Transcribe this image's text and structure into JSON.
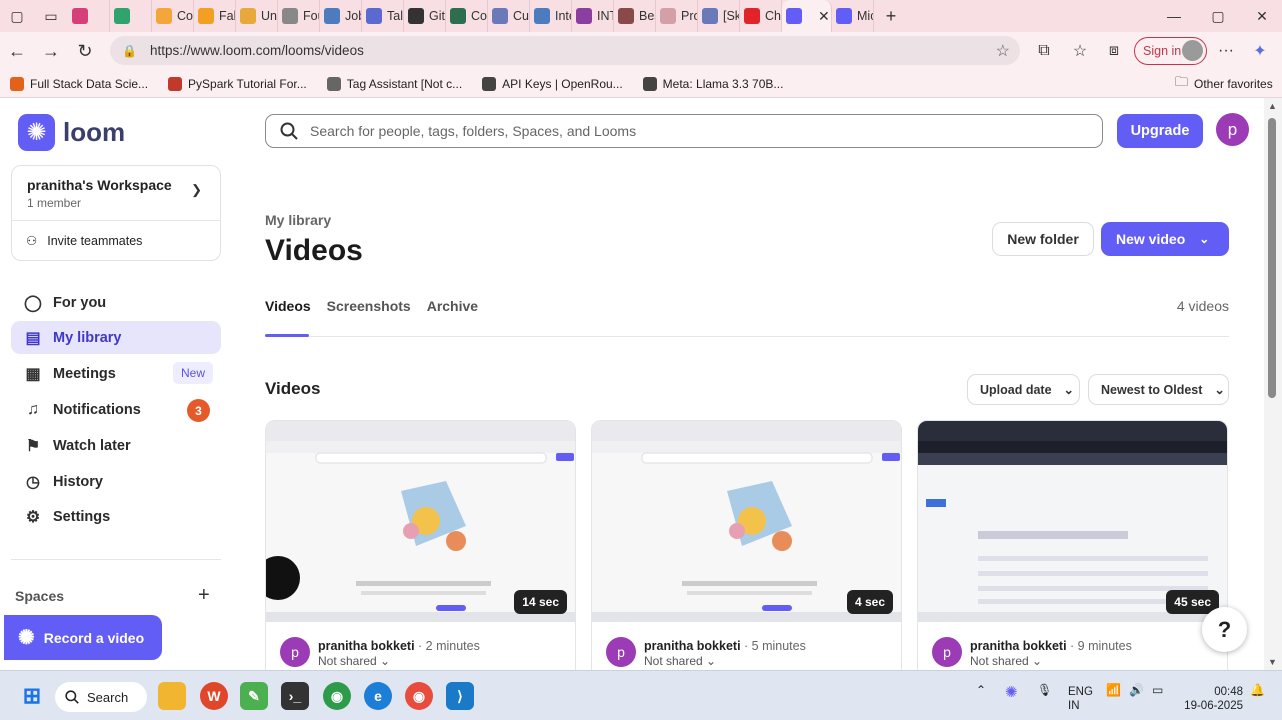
{
  "browser": {
    "tabs": [
      {
        "label": "",
        "color": "#d6407a"
      },
      {
        "label": "",
        "color": "#2fa36b"
      },
      {
        "label": "Cola",
        "color": "#f3a73b"
      },
      {
        "label": "Fake",
        "color": "#f1a024"
      },
      {
        "label": "Unti",
        "color": "#e8a93c"
      },
      {
        "label": "Fou",
        "color": "#888888"
      },
      {
        "label": "Jobs",
        "color": "#4d7cbe"
      },
      {
        "label": "Tale",
        "color": "#5a6ad1"
      },
      {
        "label": "GitH",
        "color": "#333333"
      },
      {
        "label": "Core",
        "color": "#2f6d4f"
      },
      {
        "label": "Cust",
        "color": "#6a7ab8"
      },
      {
        "label": "Inte",
        "color": "#4d7cbe"
      },
      {
        "label": "INTE",
        "color": "#8b3fa0"
      },
      {
        "label": "Best",
        "color": "#8a4a4a"
      },
      {
        "label": "Proc",
        "color": "#d3a0a8"
      },
      {
        "label": "[Ski",
        "color": "#6a7ab8"
      },
      {
        "label": "Cha",
        "color": "#e0242a"
      },
      {
        "label": "",
        "color": "#625df5",
        "active": true
      },
      {
        "label": "Mic",
        "color": "#625df5"
      }
    ],
    "url": "https://www.loom.com/looms/videos",
    "signin_label": "Sign in",
    "bookmarks": [
      {
        "label": "Full Stack Data Scie...",
        "color": "#e2621a"
      },
      {
        "label": "PySpark Tutorial For...",
        "color": "#c0392b"
      },
      {
        "label": "Tag Assistant [Not c...",
        "color": "#666666"
      },
      {
        "label": "API Keys | OpenRou...",
        "color": "#444444"
      },
      {
        "label": "Meta: Llama 3.3 70B...",
        "color": "#444444"
      }
    ],
    "other_favorites": "Other favorites"
  },
  "sidebar": {
    "brand": "loom",
    "workspace": {
      "name": "pranitha's Workspace",
      "members": "1 member",
      "invite": "Invite teammates"
    },
    "items": [
      {
        "label": "For you",
        "icon": "person-circle-icon"
      },
      {
        "label": "My library",
        "icon": "library-icon",
        "active": true
      },
      {
        "label": "Meetings",
        "icon": "calendar-icon",
        "tag": "New"
      },
      {
        "label": "Notifications",
        "icon": "bell-icon",
        "count": "3"
      },
      {
        "label": "Watch later",
        "icon": "bookmark-icon"
      },
      {
        "label": "History",
        "icon": "clock-icon"
      },
      {
        "label": "Settings",
        "icon": "gear-icon"
      }
    ],
    "spaces_label": "Spaces",
    "record_label": "Record a video"
  },
  "main": {
    "search_placeholder": "Search for people, tags, folders, Spaces, and Looms",
    "upgrade_label": "Upgrade",
    "avatar_letter": "p",
    "breadcrumb": "My library",
    "title": "Videos",
    "new_folder_label": "New folder",
    "new_video_label": "New video",
    "tabs": [
      "Videos",
      "Screenshots",
      "Archive"
    ],
    "video_count": "4 videos",
    "section_title": "Videos",
    "sort_by": "Upload date",
    "sort_order": "Newest to Oldest",
    "videos": [
      {
        "duration": "14 sec",
        "author": "pranitha bokketi",
        "ago": "2 minutes",
        "share": "Not shared",
        "thumb_caption": "Work's always better together"
      },
      {
        "duration": "4 sec",
        "author": "pranitha bokketi",
        "ago": "5 minutes",
        "share": "Not shared",
        "thumb_caption": "Work's always better together"
      },
      {
        "duration": "45 sec",
        "author": "pranitha bokketi",
        "ago": "9 minutes",
        "share": "Not shared",
        "thumb_caption": "Latest Auto-Build (2025-06-18 14:13)"
      }
    ],
    "help_label": "?"
  },
  "taskbar": {
    "search_label": "Search",
    "lang": "ENG",
    "region": "IN",
    "time": "00:48",
    "date": "19-06-2025"
  }
}
